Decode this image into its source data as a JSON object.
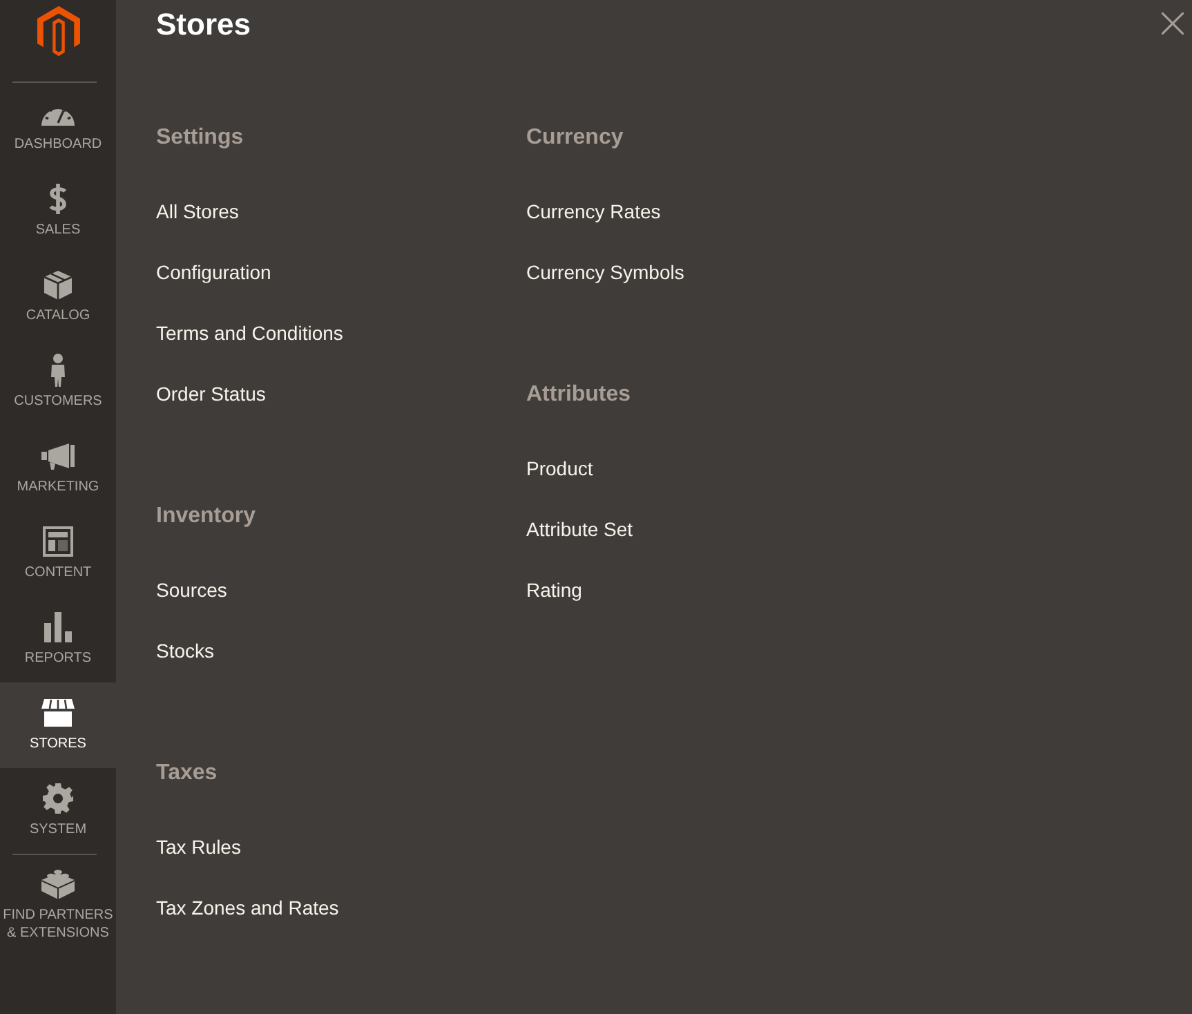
{
  "sidebar": {
    "items": [
      {
        "label": "DASHBOARD",
        "selected": false
      },
      {
        "label": "SALES",
        "selected": false
      },
      {
        "label": "CATALOG",
        "selected": false
      },
      {
        "label": "CUSTOMERS",
        "selected": false
      },
      {
        "label": "MARKETING",
        "selected": false
      },
      {
        "label": "CONTENT",
        "selected": false
      },
      {
        "label": "REPORTS",
        "selected": false
      },
      {
        "label": "STORES",
        "selected": true
      },
      {
        "label": "SYSTEM",
        "selected": false
      },
      {
        "label": "FIND PARTNERS & EXTENSIONS",
        "selected": false
      }
    ]
  },
  "panel": {
    "title": "Stores",
    "columns": [
      {
        "sections": [
          {
            "heading": "Settings",
            "links": [
              "All Stores",
              "Configuration",
              "Terms and Conditions",
              "Order Status"
            ]
          },
          {
            "heading": "Inventory",
            "links": [
              "Sources",
              "Stocks"
            ]
          },
          {
            "heading": "Taxes",
            "links": [
              "Tax Rules",
              "Tax Zones and Rates"
            ]
          }
        ]
      },
      {
        "sections": [
          {
            "heading": "Currency",
            "links": [
              "Currency Rates",
              "Currency Symbols"
            ]
          },
          {
            "heading": "Attributes",
            "links": [
              "Product",
              "Attribute Set",
              "Rating"
            ]
          }
        ]
      }
    ]
  }
}
